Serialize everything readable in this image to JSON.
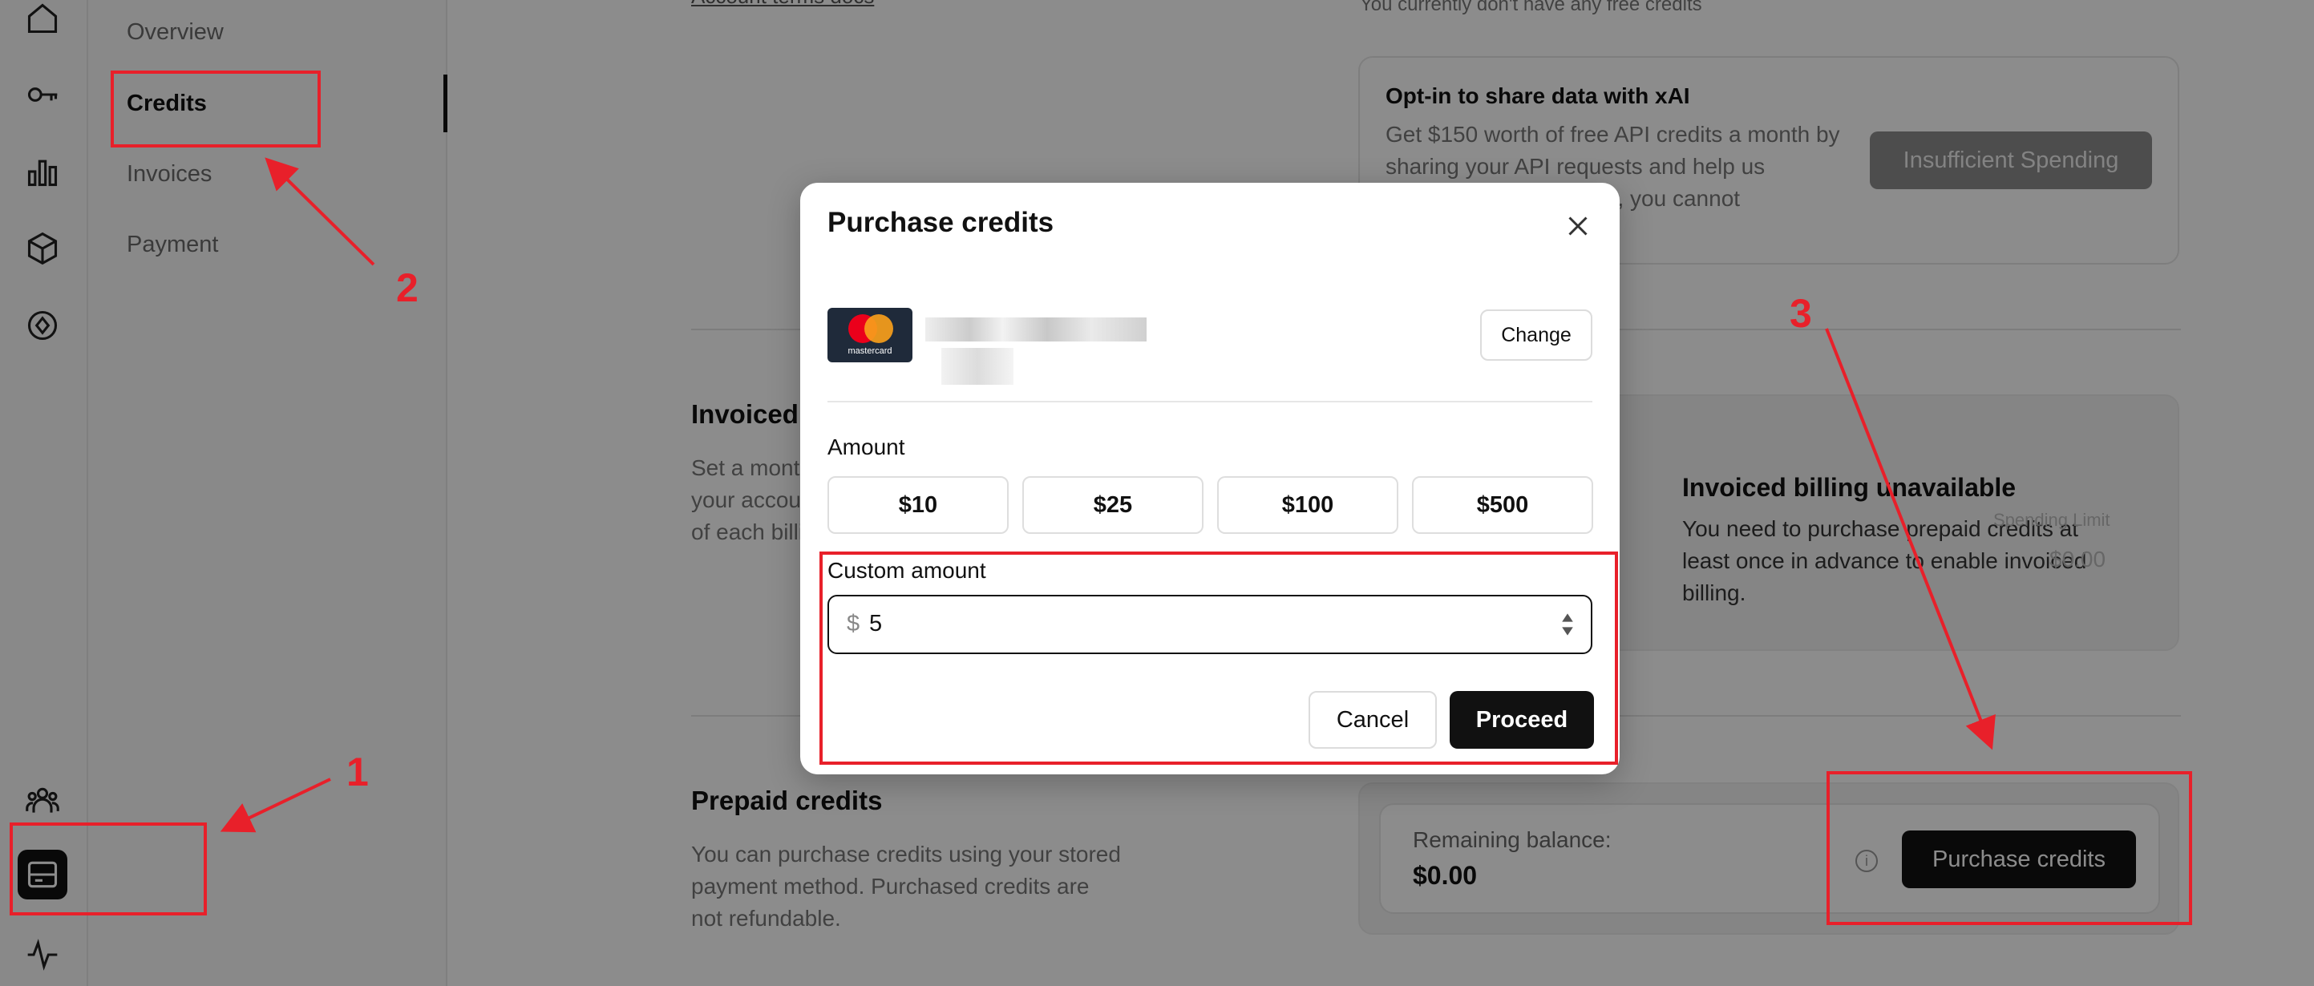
{
  "sidebar": {
    "icons": [
      "home-icon",
      "key-icon",
      "bar-chart-icon",
      "cube-icon",
      "compass-icon",
      "team-icon",
      "billing-icon",
      "activity-icon"
    ],
    "active_icon": "billing-icon"
  },
  "subnav": {
    "items": [
      {
        "label": "Overview"
      },
      {
        "label": "Credits"
      },
      {
        "label": "Invoices"
      },
      {
        "label": "Payment"
      }
    ],
    "active": "Credits"
  },
  "background": {
    "top_link": "Account terms docs",
    "free_credits_text": "You currently don't have any free credits",
    "optin": {
      "title": "Opt-in to share data with xAI",
      "desc": "Get $150 worth of free API credits a month by sharing your API requests and help us improve. Once enabled, you cannot",
      "button": "Insufficient Spending"
    },
    "invoiced": {
      "title": "Invoiced billing",
      "desc": "Set a monthly limit for invoiced billing to your account which will be billed at the end of each billing cycle.",
      "card_title": "Invoiced billing unavailable",
      "card_desc": "You need to purchase prepaid credits at least once in advance to enable invoiced billing.",
      "spending_label": "Spending Limit",
      "spending_value": "$0.00"
    },
    "prepaid": {
      "title": "Prepaid credits",
      "desc": "You can purchase credits using your stored payment method. Purchased credits are not refundable.",
      "balance_label": "Remaining balance:",
      "balance_value": "$0.00",
      "purchase_button": "Purchase credits"
    }
  },
  "modal": {
    "title": "Purchase credits",
    "card_brand": "mastercard",
    "change_button": "Change",
    "amount_label": "Amount",
    "amounts": [
      "$10",
      "$25",
      "$100",
      "$500"
    ],
    "custom_label": "Custom amount",
    "currency_prefix": "$",
    "custom_value": "5",
    "cancel_button": "Cancel",
    "proceed_button": "Proceed"
  },
  "annotations": {
    "numbers": [
      "1",
      "2",
      "3"
    ],
    "color": "#e8202a"
  }
}
